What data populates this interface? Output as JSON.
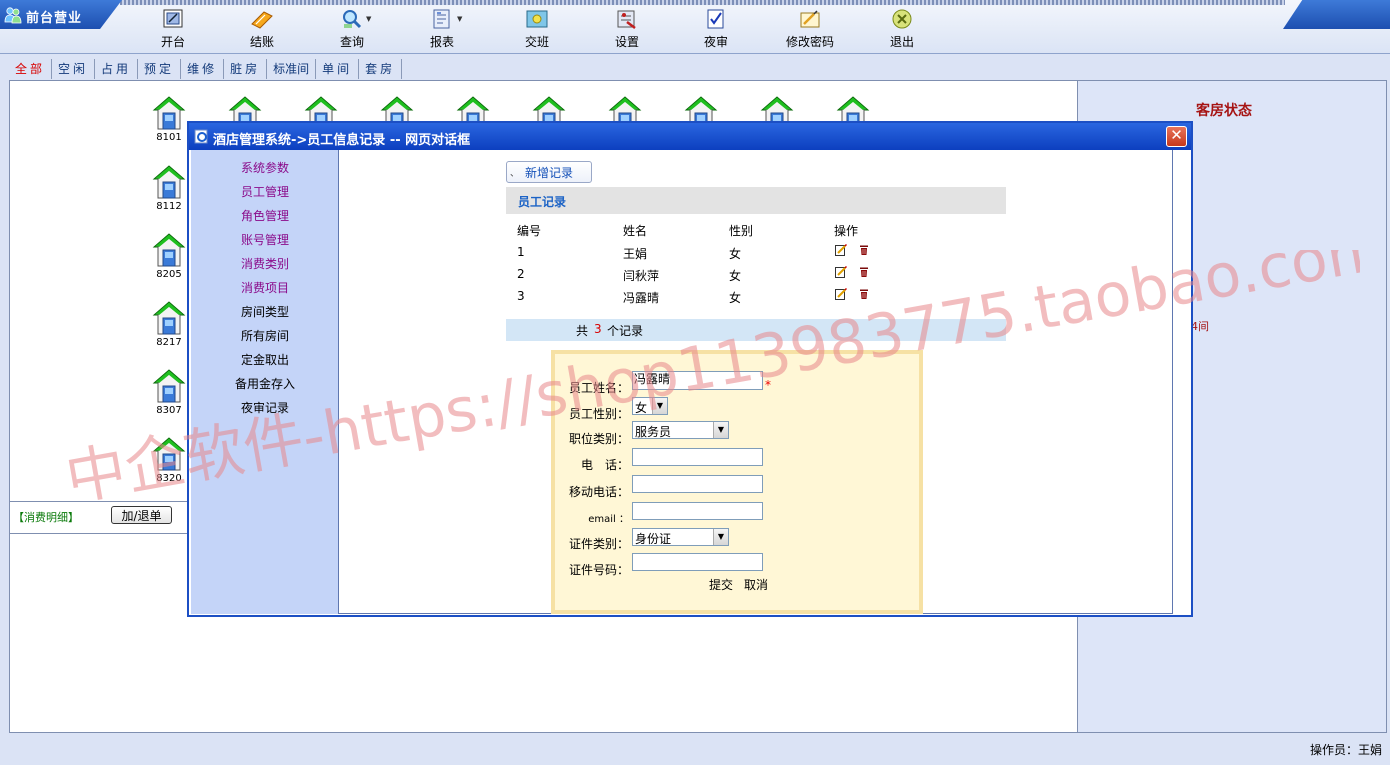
{
  "brand": {
    "label": "前台营业"
  },
  "toolbar": [
    {
      "key": "open",
      "label": "开台",
      "icon": "open-table-icon"
    },
    {
      "key": "checkout",
      "label": "结账",
      "icon": "checkout-icon"
    },
    {
      "key": "query",
      "label": "查询",
      "icon": "query-icon",
      "dropdown": true
    },
    {
      "key": "report",
      "label": "报表",
      "icon": "report-icon",
      "dropdown": true
    },
    {
      "key": "shift",
      "label": "交班",
      "icon": "shift-icon"
    },
    {
      "key": "settings",
      "label": "设置",
      "icon": "settings-icon"
    },
    {
      "key": "night",
      "label": "夜审",
      "icon": "night-audit-icon"
    },
    {
      "key": "password",
      "label": "修改密码",
      "icon": "password-icon"
    },
    {
      "key": "exit",
      "label": "退出",
      "icon": "exit-icon"
    }
  ],
  "tabs": [
    "全部",
    "空闲",
    "占用",
    "预定",
    "维修",
    "脏房",
    "标准间",
    "单间",
    "套房"
  ],
  "rooms": {
    "row1": [
      "8101",
      "",
      "",
      "",
      "",
      "",
      "",
      "",
      "",
      ""
    ],
    "column": [
      "8112",
      "8205",
      "8217",
      "8307",
      "8320"
    ]
  },
  "consume": {
    "label": "【消费明细】",
    "button": "加/退单"
  },
  "status_panel": {
    "title": "客房状态",
    "fragment": "4间"
  },
  "operator": "操作员：王娟",
  "dialog": {
    "title": "酒店管理系统->员工信息记录  --  网页对话框",
    "close": "✕",
    "menu": [
      {
        "label": "系统参数",
        "purple": true
      },
      {
        "label": "员工管理",
        "purple": true
      },
      {
        "label": "角色管理",
        "purple": true
      },
      {
        "label": "账号管理",
        "purple": true
      },
      {
        "label": "消费类别",
        "purple": true
      },
      {
        "label": "消费项目",
        "purple": true
      },
      {
        "label": "房间类型",
        "purple": false
      },
      {
        "label": "所有房间",
        "purple": false
      },
      {
        "label": "定金取出",
        "purple": false
      },
      {
        "label": "备用金存入",
        "purple": false
      },
      {
        "label": "夜审记录",
        "purple": false
      }
    ],
    "new_record": "新增记录",
    "records": {
      "title": "员工记录",
      "headers": [
        "编号",
        "姓名",
        "性别",
        "操作"
      ],
      "rows": [
        {
          "id": "1",
          "name": "王娟",
          "gender": "女"
        },
        {
          "id": "2",
          "name": "闫秋萍",
          "gender": "女"
        },
        {
          "id": "3",
          "name": "冯露晴",
          "gender": "女"
        }
      ],
      "footer_prefix": "共",
      "footer_count": "3",
      "footer_suffix": "个记录"
    },
    "form": {
      "name_label": "员工姓名：",
      "name_value": "冯露晴",
      "required": "*",
      "gender_label": "员工性别：",
      "gender_value": "女",
      "position_label": "职位类别：",
      "position_value": "服务员",
      "phone_label": "电　话：",
      "phone_value": "",
      "mobile_label": "移动电话：",
      "mobile_value": "",
      "email_label": "email ：",
      "email_value": "",
      "idtype_label": "证件类别：",
      "idtype_value": "身份证",
      "idnum_label": "证件号码：",
      "idnum_value": "",
      "submit": "提交",
      "cancel": "取消"
    }
  },
  "watermark": "中企软件-https://shop113983775.taobao.com",
  "colors": {
    "titlebar": "#0c3fbf",
    "room_roof": "#1fbf1f",
    "menu_purple": "#8a0a8a",
    "status_red": "#a61414",
    "watermark": "#e8878a"
  }
}
